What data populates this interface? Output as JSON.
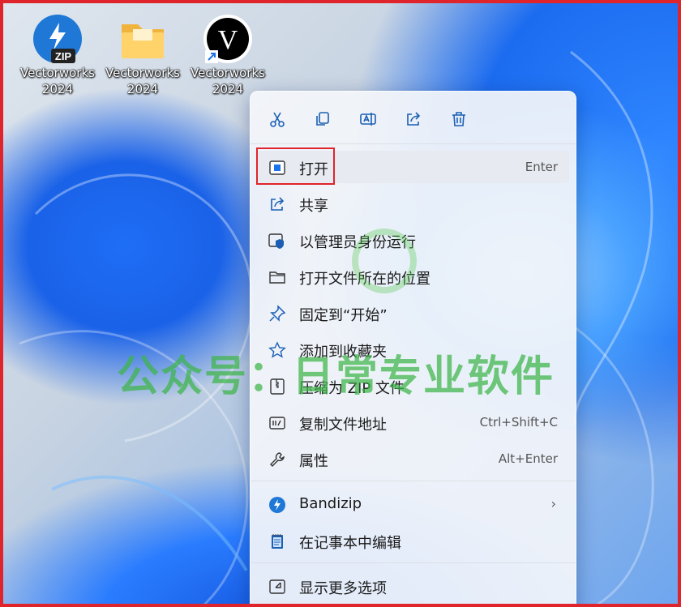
{
  "desktop": {
    "icons": [
      {
        "label": "Vectorworks\n2024",
        "icon": "zip-archive-icon",
        "badge": "ZIP"
      },
      {
        "label": "Vectorworks\n2024",
        "icon": "folder-icon"
      },
      {
        "label": "Vectorworks\n2024",
        "icon": "vectorworks-shortcut-icon",
        "letter": "V"
      }
    ]
  },
  "context_menu": {
    "toolbar": [
      "cut-icon",
      "copy-icon",
      "rename-icon",
      "share-icon",
      "delete-icon"
    ],
    "items": [
      {
        "label": "打开",
        "shortcut": "Enter",
        "icon": "open-app-icon"
      },
      {
        "label": "共享",
        "icon": "share-icon"
      },
      {
        "label": "以管理员身份运行",
        "icon": "admin-shield-icon"
      },
      {
        "label": "打开文件所在的位置",
        "icon": "folder-outline-icon"
      },
      {
        "label": "固定到“开始”",
        "icon": "pin-icon"
      },
      {
        "label": "添加到收藏夹",
        "icon": "star-icon"
      },
      {
        "label": "压缩为 ZIP 文件",
        "icon": "zip-icon"
      },
      {
        "label": "复制文件地址",
        "shortcut": "Ctrl+Shift+C",
        "icon": "copy-path-icon"
      },
      {
        "label": "属性",
        "shortcut": "Alt+Enter",
        "icon": "wrench-icon"
      },
      {
        "label": "Bandizip",
        "icon": "bandizip-icon",
        "submenu": "›"
      },
      {
        "label": "在记事本中编辑",
        "icon": "notepad-icon"
      },
      {
        "label": "显示更多选项",
        "icon": "more-options-icon"
      }
    ]
  },
  "watermark": {
    "text": "公众号：日常专业软件"
  },
  "colors": {
    "accent": "#1a73e8",
    "highlight_border": "#e0242b",
    "watermark": "#3cb446"
  }
}
